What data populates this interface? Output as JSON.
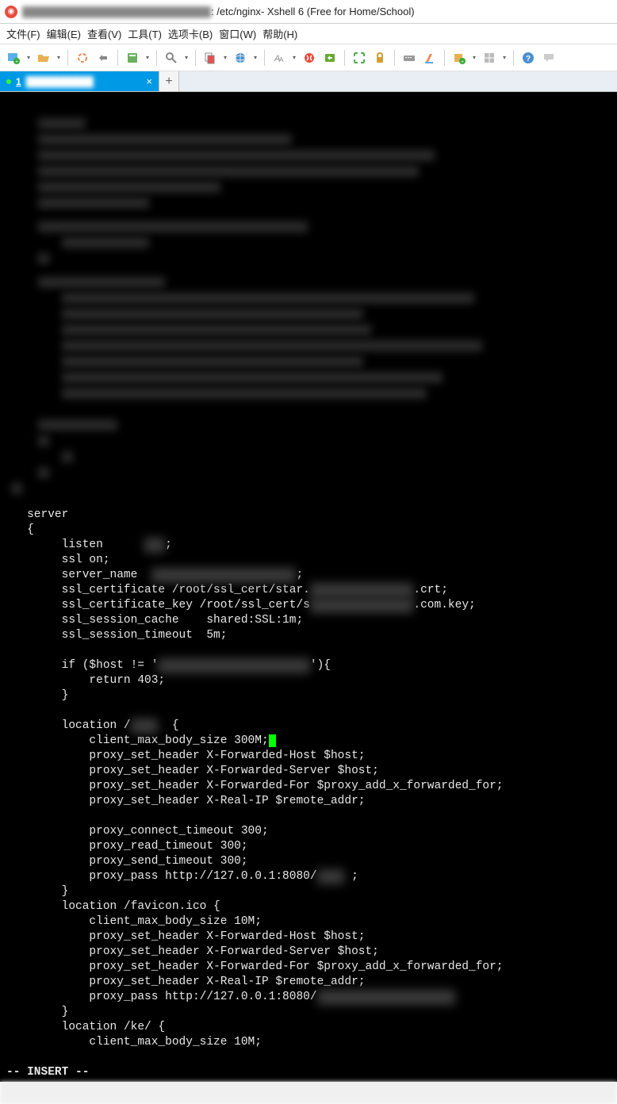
{
  "window": {
    "title_path": ": /etc/nginx",
    "title_app": " - Xshell 6 (Free for Home/School)"
  },
  "menu": {
    "file": "文件(F)",
    "edit": "编辑(E)",
    "view": "查看(V)",
    "tools": "工具(T)",
    "tabs": "选项卡(B)",
    "window": "窗口(W)",
    "help": "帮助(H)"
  },
  "tab": {
    "num": "1",
    "label_blur": "██████████"
  },
  "terminal": {
    "lines": [
      "   server",
      "   {",
      "        listen      ███;",
      "        ssl on;",
      "        server_name  █████████████████████;",
      "        ssl_certificate /root/ssl_cert/star.███████████████.crt;",
      "        ssl_certificate_key /root/ssl_cert/s███████████████.com.key;",
      "        ssl_session_cache    shared:SSL:1m;",
      "        ssl_session_timeout  5m;",
      "",
      "        if ($host != '██████████████████████'){",
      "            return 403;",
      "        }",
      "",
      "        location /████  {",
      "            client_max_body_size 300M;▮",
      "            proxy_set_header X-Forwarded-Host $host;",
      "            proxy_set_header X-Forwarded-Server $host;",
      "            proxy_set_header X-Forwarded-For $proxy_add_x_forwarded_for;",
      "            proxy_set_header X-Real-IP $remote_addr;",
      "",
      "            proxy_connect_timeout 300;",
      "            proxy_read_timeout 300;",
      "            proxy_send_timeout 300;",
      "            proxy_pass http://127.0.0.1:8080/████ ;",
      "        }",
      "        location /favicon.ico {",
      "            client_max_body_size 10M;",
      "            proxy_set_header X-Forwarded-Host $host;",
      "            proxy_set_header X-Forwarded-Server $host;",
      "            proxy_set_header X-Forwarded-For $proxy_add_x_forwarded_for;",
      "            proxy_set_header X-Real-IP $remote_addr;",
      "            proxy_pass http://127.0.0.1:8080/████████████████████",
      "        }",
      "        location /ke/ {",
      "            client_max_body_size 10M;"
    ],
    "mode": "-- INSERT --"
  }
}
